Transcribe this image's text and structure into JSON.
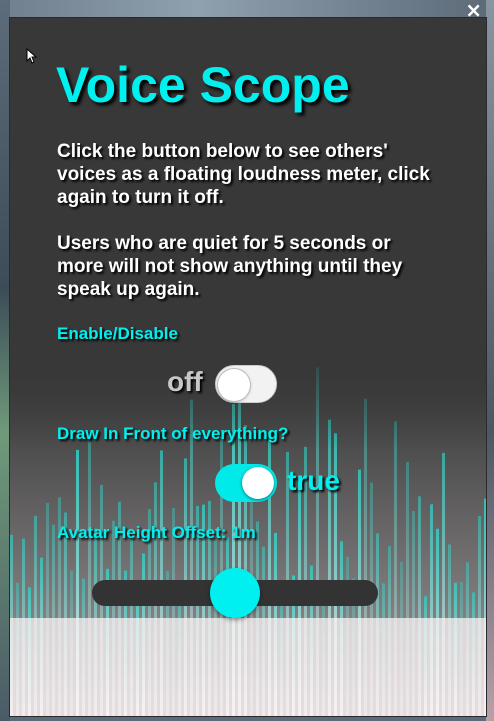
{
  "window": {
    "close_glyph": "×"
  },
  "title": "Voice Scope",
  "description": [
    "Click the button below to see others' voices as a floating loudness meter, click again to turn it off.",
    "Users who are quiet for 5 seconds or more will not show anything until they speak up again."
  ],
  "enable": {
    "label": "Enable/Disable",
    "state_text": "off",
    "checked": false
  },
  "draw_in_front": {
    "label": "Draw In Front of everything?",
    "state_text": "true",
    "checked": true
  },
  "height_offset": {
    "label": "Avatar Height Offset: 1m",
    "value_fraction": 0.5
  },
  "icons": {
    "cursor": "cursor-arrow-icon",
    "close": "close-icon"
  },
  "colors": {
    "accent": "#00f0f0",
    "panel": "#383838",
    "off_text": "#c8c8c8"
  }
}
